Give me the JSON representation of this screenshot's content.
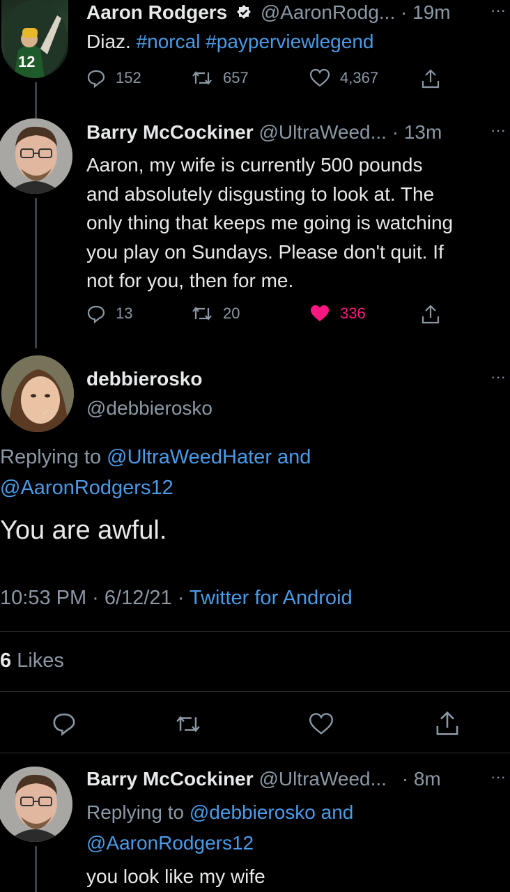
{
  "tweet1": {
    "display_name": "Aaron Rodgers",
    "handle": "@AaronRodg...",
    "time": "· 19m",
    "text_plain": "Diaz.",
    "hashtags": "#norcal #payperviewlegend",
    "replies": "152",
    "retweets": "657",
    "likes": "4,367",
    "jersey_number": "12"
  },
  "tweet2": {
    "display_name": "Barry McCockiner",
    "handle": "@UltraWeed...",
    "time": "· 13m",
    "lines": [
      "Aaron, my wife is currently 500 pounds",
      "and absolutely disgusting to look at. The",
      "only thing that keeps me going is watching",
      "you play on Sundays. Please don't quit. If",
      "not for you, then for me."
    ],
    "replies": "13",
    "retweets": "20",
    "likes": "336"
  },
  "main": {
    "display_name": "debbierosko",
    "handle": "@debbierosko",
    "replying_prefix": "Replying to",
    "reply_handle1": "@UltraWeedHater",
    "reply_and": "and",
    "reply_handle2": "@AaronRodgers12",
    "text": "You are awful.",
    "timestamp": "10:53 PM · 6/12/21 ·",
    "source": "Twitter for Android",
    "likes_count": "6",
    "likes_label": "Likes"
  },
  "tweet3": {
    "display_name": "Barry McCockiner",
    "handle": "@UltraWeed...",
    "time": "· 8m",
    "replying_prefix": "Replying to",
    "reply_handle1": "@debbierosko",
    "reply_and": "and",
    "reply_handle2": "@AaronRodgers12",
    "text": "you look like my wife"
  },
  "more_icon": "···",
  "colors": {
    "background": "#000000",
    "link": "#4a9be8",
    "like_active": "#f91880",
    "muted": "#8b98a5"
  }
}
